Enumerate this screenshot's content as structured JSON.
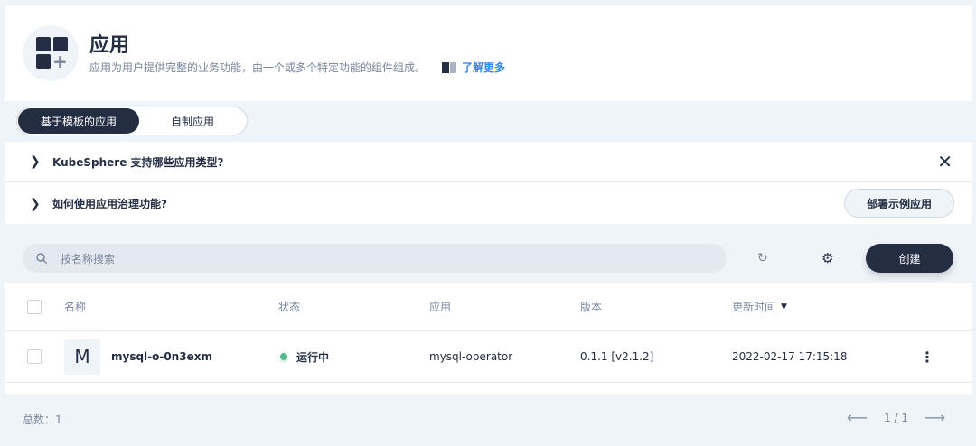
{
  "header": {
    "title": "应用",
    "description": "应用为用户提供完整的业务功能，由一个或多个特定功能的组件组成。",
    "learn_more": "了解更多"
  },
  "tabs": [
    {
      "label": "基于模板的应用",
      "active": true
    },
    {
      "label": "自制应用",
      "active": false
    }
  ],
  "faq": [
    {
      "label": "KubeSphere 支持哪些应用类型?"
    },
    {
      "label": "如何使用应用治理功能?"
    }
  ],
  "deploy_sample_label": "部署示例应用",
  "toolbar": {
    "search_placeholder": "按名称搜索",
    "create_label": "创建"
  },
  "table": {
    "columns": [
      "名称",
      "状态",
      "应用",
      "版本",
      "更新时间"
    ],
    "rows": [
      {
        "avatar": "M",
        "name": "mysql-o-0n3exm",
        "status": "运行中",
        "status_color": "#55bc8a",
        "app": "mysql-operator",
        "version": "0.1.1 [v2.1.2]",
        "updated": "2022-02-17 17:15:18"
      }
    ]
  },
  "footer": {
    "total": "总数：1",
    "page": "1 / 1"
  }
}
